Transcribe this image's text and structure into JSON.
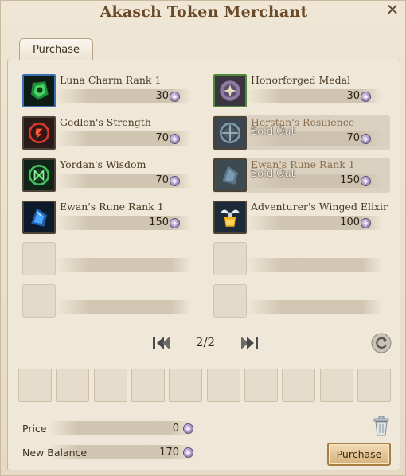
{
  "window": {
    "title": "Akasch Token Merchant",
    "close_label": "✕"
  },
  "tabs": [
    {
      "label": "Purchase"
    }
  ],
  "items": [
    {
      "name": "Luna Charm Rank 1",
      "price": "30",
      "sold_out": false,
      "icon": "luna-charm-icon",
      "border": "#3a6fb0"
    },
    {
      "name": "Honorforged Medal",
      "price": "30",
      "sold_out": false,
      "icon": "honorforged-medal-icon",
      "border": "#4f8a3a"
    },
    {
      "name": "Gedlon's Strength",
      "price": "70",
      "sold_out": false,
      "icon": "gedlons-strength-icon",
      "border": "#4d4236"
    },
    {
      "name": "Herstan's Resilience",
      "price": "70",
      "sold_out": true,
      "sold_label": "Sold Out",
      "icon": "herstans-resilience-icon",
      "border": "#4d4236"
    },
    {
      "name": "Yordan's Wisdom",
      "price": "70",
      "sold_out": false,
      "icon": "yordans-wisdom-icon",
      "border": "#4d4236"
    },
    {
      "name": "Ewan's Rune Rank 1",
      "price": "150",
      "sold_out": true,
      "sold_label": "Sold Out",
      "icon": "ewans-rune-icon",
      "border": "#4d4236"
    },
    {
      "name": "Ewan's Rune Rank 1",
      "price": "150",
      "sold_out": false,
      "icon": "ewans-rune-icon",
      "border": "#4d4236"
    },
    {
      "name": "Adventurer's Winged Elixir",
      "price": "100",
      "sold_out": false,
      "icon": "winged-elixir-icon",
      "border": "#4d4236"
    }
  ],
  "pagination": {
    "current": "2/2"
  },
  "summary": {
    "price_label": "Price",
    "price_value": "0",
    "balance_label": "New Balance",
    "balance_value": "170"
  },
  "purchase_button": {
    "label": "Purchase"
  },
  "currency_icon": "akasch-token-icon",
  "colors": {
    "title": "#6a4a28",
    "purchase_button": "#d7b27c",
    "token": "#8a74a8"
  }
}
